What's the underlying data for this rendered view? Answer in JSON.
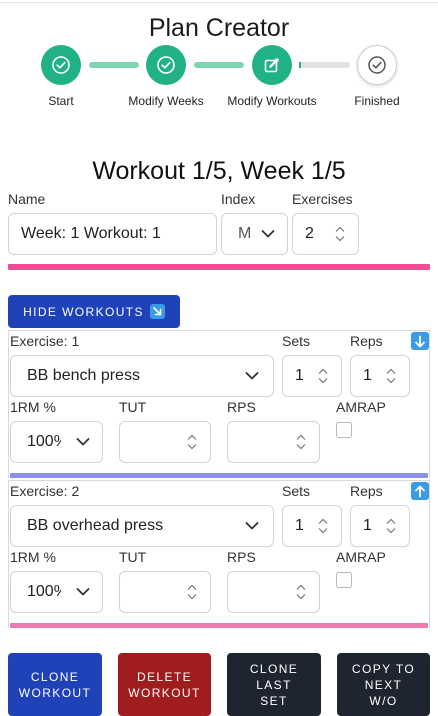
{
  "app": {
    "title": "Plan Creator"
  },
  "stepper": {
    "steps": [
      {
        "label": "Start",
        "status": "done",
        "icon": "check-circle-icon"
      },
      {
        "label": "Modify Weeks",
        "status": "done",
        "icon": "check-circle-icon"
      },
      {
        "label": "Modify Workouts",
        "status": "current",
        "icon": "edit-icon"
      },
      {
        "label": "Finished",
        "status": "todo",
        "icon": "check-circle-icon"
      }
    ]
  },
  "workout": {
    "heading": "Workout 1/5, Week 1/5",
    "name_label": "Name",
    "name_value": "Week: 1 Workout: 1",
    "index_label": "Index",
    "index_value": "M",
    "exercises_label": "Exercises",
    "exercises_value": "2"
  },
  "hide_button": {
    "label": "HIDE WORKOUTS",
    "icon": "arrow-down-right-icon"
  },
  "exercises": [
    {
      "title": "Exercise: 1",
      "name": "BB bench press",
      "sets_label": "Sets",
      "sets_value": "1",
      "reps_label": "Reps",
      "reps_value": "1",
      "orm_label": "1RM %",
      "orm_value": "100%",
      "tut_label": "TUT",
      "tut_value": "",
      "rps_label": "RPS",
      "rps_value": "",
      "amrap_label": "AMRAP",
      "move_icon": "arrow-down-icon",
      "bar_color": "#8a93e6"
    },
    {
      "title": "Exercise: 2",
      "name": "BB overhead press",
      "sets_label": "Sets",
      "sets_value": "1",
      "reps_label": "Reps",
      "reps_value": "1",
      "orm_label": "1RM %",
      "orm_value": "100%",
      "tut_label": "TUT",
      "tut_value": "",
      "rps_label": "RPS",
      "rps_value": "",
      "amrap_label": "AMRAP",
      "move_icon": "arrow-up-icon",
      "bar_color": "#f07ab0"
    }
  ],
  "actions": {
    "clone_workout": "CLONE WORKOUT",
    "delete_workout": "DELETE WORKOUT",
    "clone_last_set": "CLONE LAST SET",
    "copy_next": "COPY TO NEXT W/O"
  },
  "colors": {
    "step_done": "#20b284",
    "primary": "#1f42b9",
    "danger": "#a11c1c",
    "dark": "#1f2530",
    "divider_pink": "#ec4d94"
  }
}
